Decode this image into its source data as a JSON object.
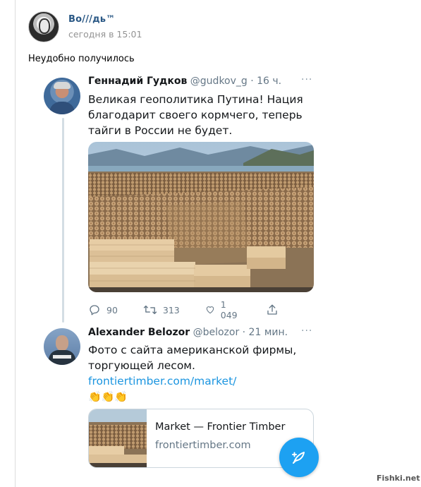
{
  "post": {
    "author": "Во///дь™",
    "time": "сегодня в 15:01",
    "text": "Неудобно получилось"
  },
  "tweet1": {
    "name": "Геннадий Гудков",
    "handle_time": "@gudkov_g · 16 ч.",
    "text_lines": [
      "Великая геополитика Путина! Нация",
      "благодарит своего кормчего, теперь",
      "тайги в России не будет."
    ],
    "replies": "90",
    "retweets": "313",
    "likes": "1 049",
    "more": "···"
  },
  "tweet2": {
    "name": "Alexander Belozor",
    "handle_time": "@belozor · 21 мин.",
    "text_lines": [
      "Фото с сайта американской фирмы,",
      "торгующей лесом."
    ],
    "link": "frontiertimber.com/market/",
    "emoji": "👏👏👏",
    "more": "···"
  },
  "link_card": {
    "title": "Market — Frontier Timber",
    "domain": "frontiertimber.com"
  },
  "watermark": "Fishki.net",
  "colors": {
    "vk_link": "#2a5885",
    "twitter_blue": "#1da1f2",
    "twitter_link": "#1b95e0",
    "gray_text": "#657786"
  },
  "icons": [
    "reply-icon",
    "retweet-icon",
    "like-icon",
    "share-icon",
    "compose-icon"
  ]
}
